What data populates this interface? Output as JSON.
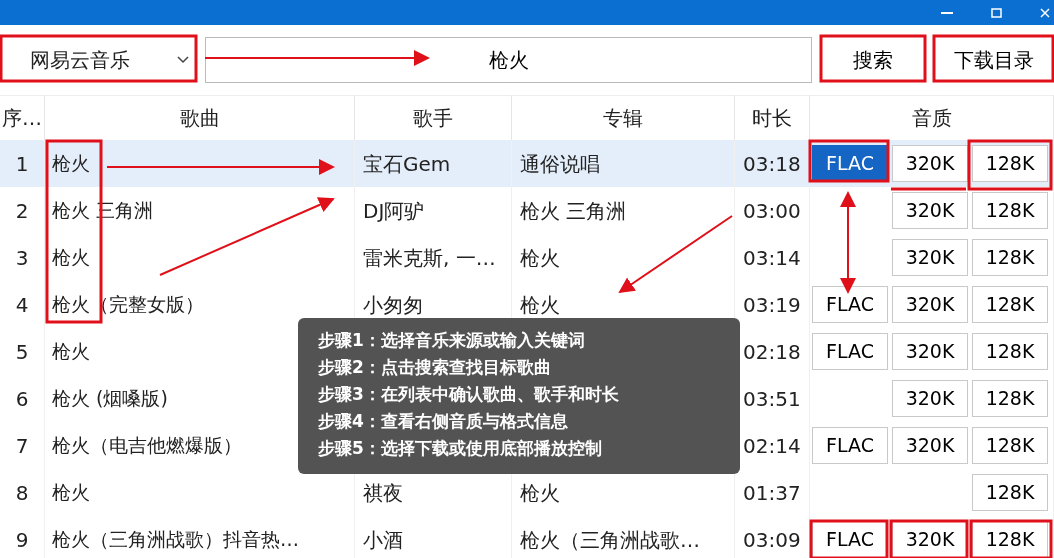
{
  "toolbar": {
    "source": "网易云音乐",
    "search_value": "枪火",
    "buttons": [
      "搜索",
      "下载目录"
    ]
  },
  "table": {
    "columns": [
      "序…",
      "歌曲",
      "歌手",
      "专辑",
      "时长",
      "音质"
    ],
    "rows": [
      {
        "index": "1",
        "song": "枪火",
        "singer": "宝石Gem",
        "album": "通俗说唱",
        "duration": "03:18",
        "selected": true,
        "quality": [
          {
            "kind": "flac",
            "label": "FLAC",
            "selected": true
          },
          {
            "kind": "k320",
            "label": "320K",
            "selected": false
          },
          {
            "kind": "k128",
            "label": "128K",
            "selected": false
          }
        ]
      },
      {
        "index": "2",
        "song": "枪火 三角洲",
        "singer": "DJ阿驴",
        "album": "枪火 三角洲",
        "duration": "03:00",
        "selected": false,
        "quality": [
          {
            "kind": "k320",
            "label": "320K",
            "selected": false
          },
          {
            "kind": "k128",
            "label": "128K",
            "selected": false
          }
        ]
      },
      {
        "index": "3",
        "song": "枪火",
        "singer": "雷米克斯, 一…",
        "album": "枪火",
        "duration": "03:14",
        "selected": false,
        "quality": [
          {
            "kind": "k320",
            "label": "320K",
            "selected": false
          },
          {
            "kind": "k128",
            "label": "128K",
            "selected": false
          }
        ]
      },
      {
        "index": "4",
        "song": "枪火（完整女版）",
        "singer": "小匆匆",
        "album": "枪火",
        "duration": "03:19",
        "selected": false,
        "quality": [
          {
            "kind": "flac",
            "label": "FLAC",
            "selected": false
          },
          {
            "kind": "k320",
            "label": "320K",
            "selected": false
          },
          {
            "kind": "k128",
            "label": "128K",
            "selected": false
          }
        ]
      },
      {
        "index": "5",
        "song": "枪火",
        "duration": "02:18",
        "selected": false,
        "quality": [
          {
            "kind": "flac",
            "label": "FLAC",
            "selected": false
          },
          {
            "kind": "k320",
            "label": "320K",
            "selected": false
          },
          {
            "kind": "k128",
            "label": "128K",
            "selected": false
          }
        ]
      },
      {
        "index": "6",
        "song": "枪火 (烟嗓版)",
        "duration": "03:51",
        "selected": false,
        "quality": [
          {
            "kind": "k320",
            "label": "320K",
            "selected": false
          },
          {
            "kind": "k128",
            "label": "128K",
            "selected": false
          }
        ]
      },
      {
        "index": "7",
        "song": "枪火（电吉他燃爆版）",
        "duration": "02:14",
        "selected": false,
        "quality": [
          {
            "kind": "flac",
            "label": "FLAC",
            "selected": false
          },
          {
            "kind": "k320",
            "label": "320K",
            "selected": false
          },
          {
            "kind": "k128",
            "label": "128K",
            "selected": false
          }
        ]
      },
      {
        "index": "8",
        "song": "枪火",
        "singer": "祺夜",
        "album": "枪火",
        "duration": "01:37",
        "selected": false,
        "quality": [
          {
            "kind": "k128",
            "label": "128K",
            "selected": false
          }
        ]
      },
      {
        "index": "9",
        "song": "枪火（三角洲战歌）抖音热…",
        "singer": "小酒",
        "album": "枪火（三角洲战歌…",
        "duration": "03:09",
        "selected": false,
        "quality": [
          {
            "kind": "flac",
            "label": "FLAC",
            "selected": false
          },
          {
            "kind": "k320",
            "label": "320K",
            "selected": false
          },
          {
            "kind": "k128",
            "label": "128K",
            "selected": false
          }
        ]
      }
    ]
  },
  "steps": [
    "步骤1：选择音乐来源或输入关键词",
    "步骤2：点击搜索查找目标歌曲",
    "步骤3：在列表中确认歌曲、歌手和时长",
    "步骤4：查看右侧音质与格式信息",
    "步骤5：选择下载或使用底部播放控制"
  ]
}
